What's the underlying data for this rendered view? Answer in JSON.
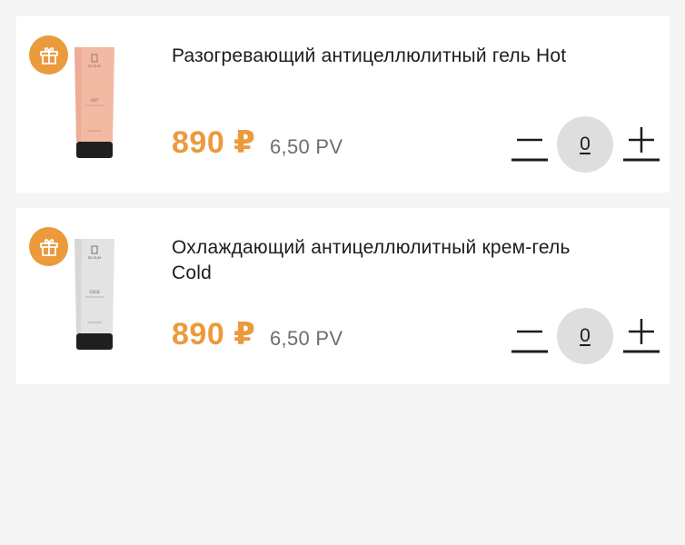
{
  "products": [
    {
      "title": "Разогревающий антицеллюлитный гель Hot",
      "price": "890 ₽",
      "pv": "6,50 PV",
      "quantity": "0",
      "tube_color": "#f2b9a3",
      "tube_label": "HOT"
    },
    {
      "title": "Охлаждающий антицеллюлитный крем-гель Cold",
      "price": "890 ₽",
      "pv": "6,50 PV",
      "quantity": "0",
      "tube_color": "#e3e3e3",
      "tube_label": "COLD"
    }
  ],
  "colors": {
    "accent": "#eb9a3c",
    "pv_text": "#6e6e6e",
    "qty_bg": "#dedede",
    "page_bg": "#f5f5f5"
  },
  "icons": {
    "gift": "gift-icon",
    "minus": "minus-icon",
    "plus": "plus-icon"
  }
}
